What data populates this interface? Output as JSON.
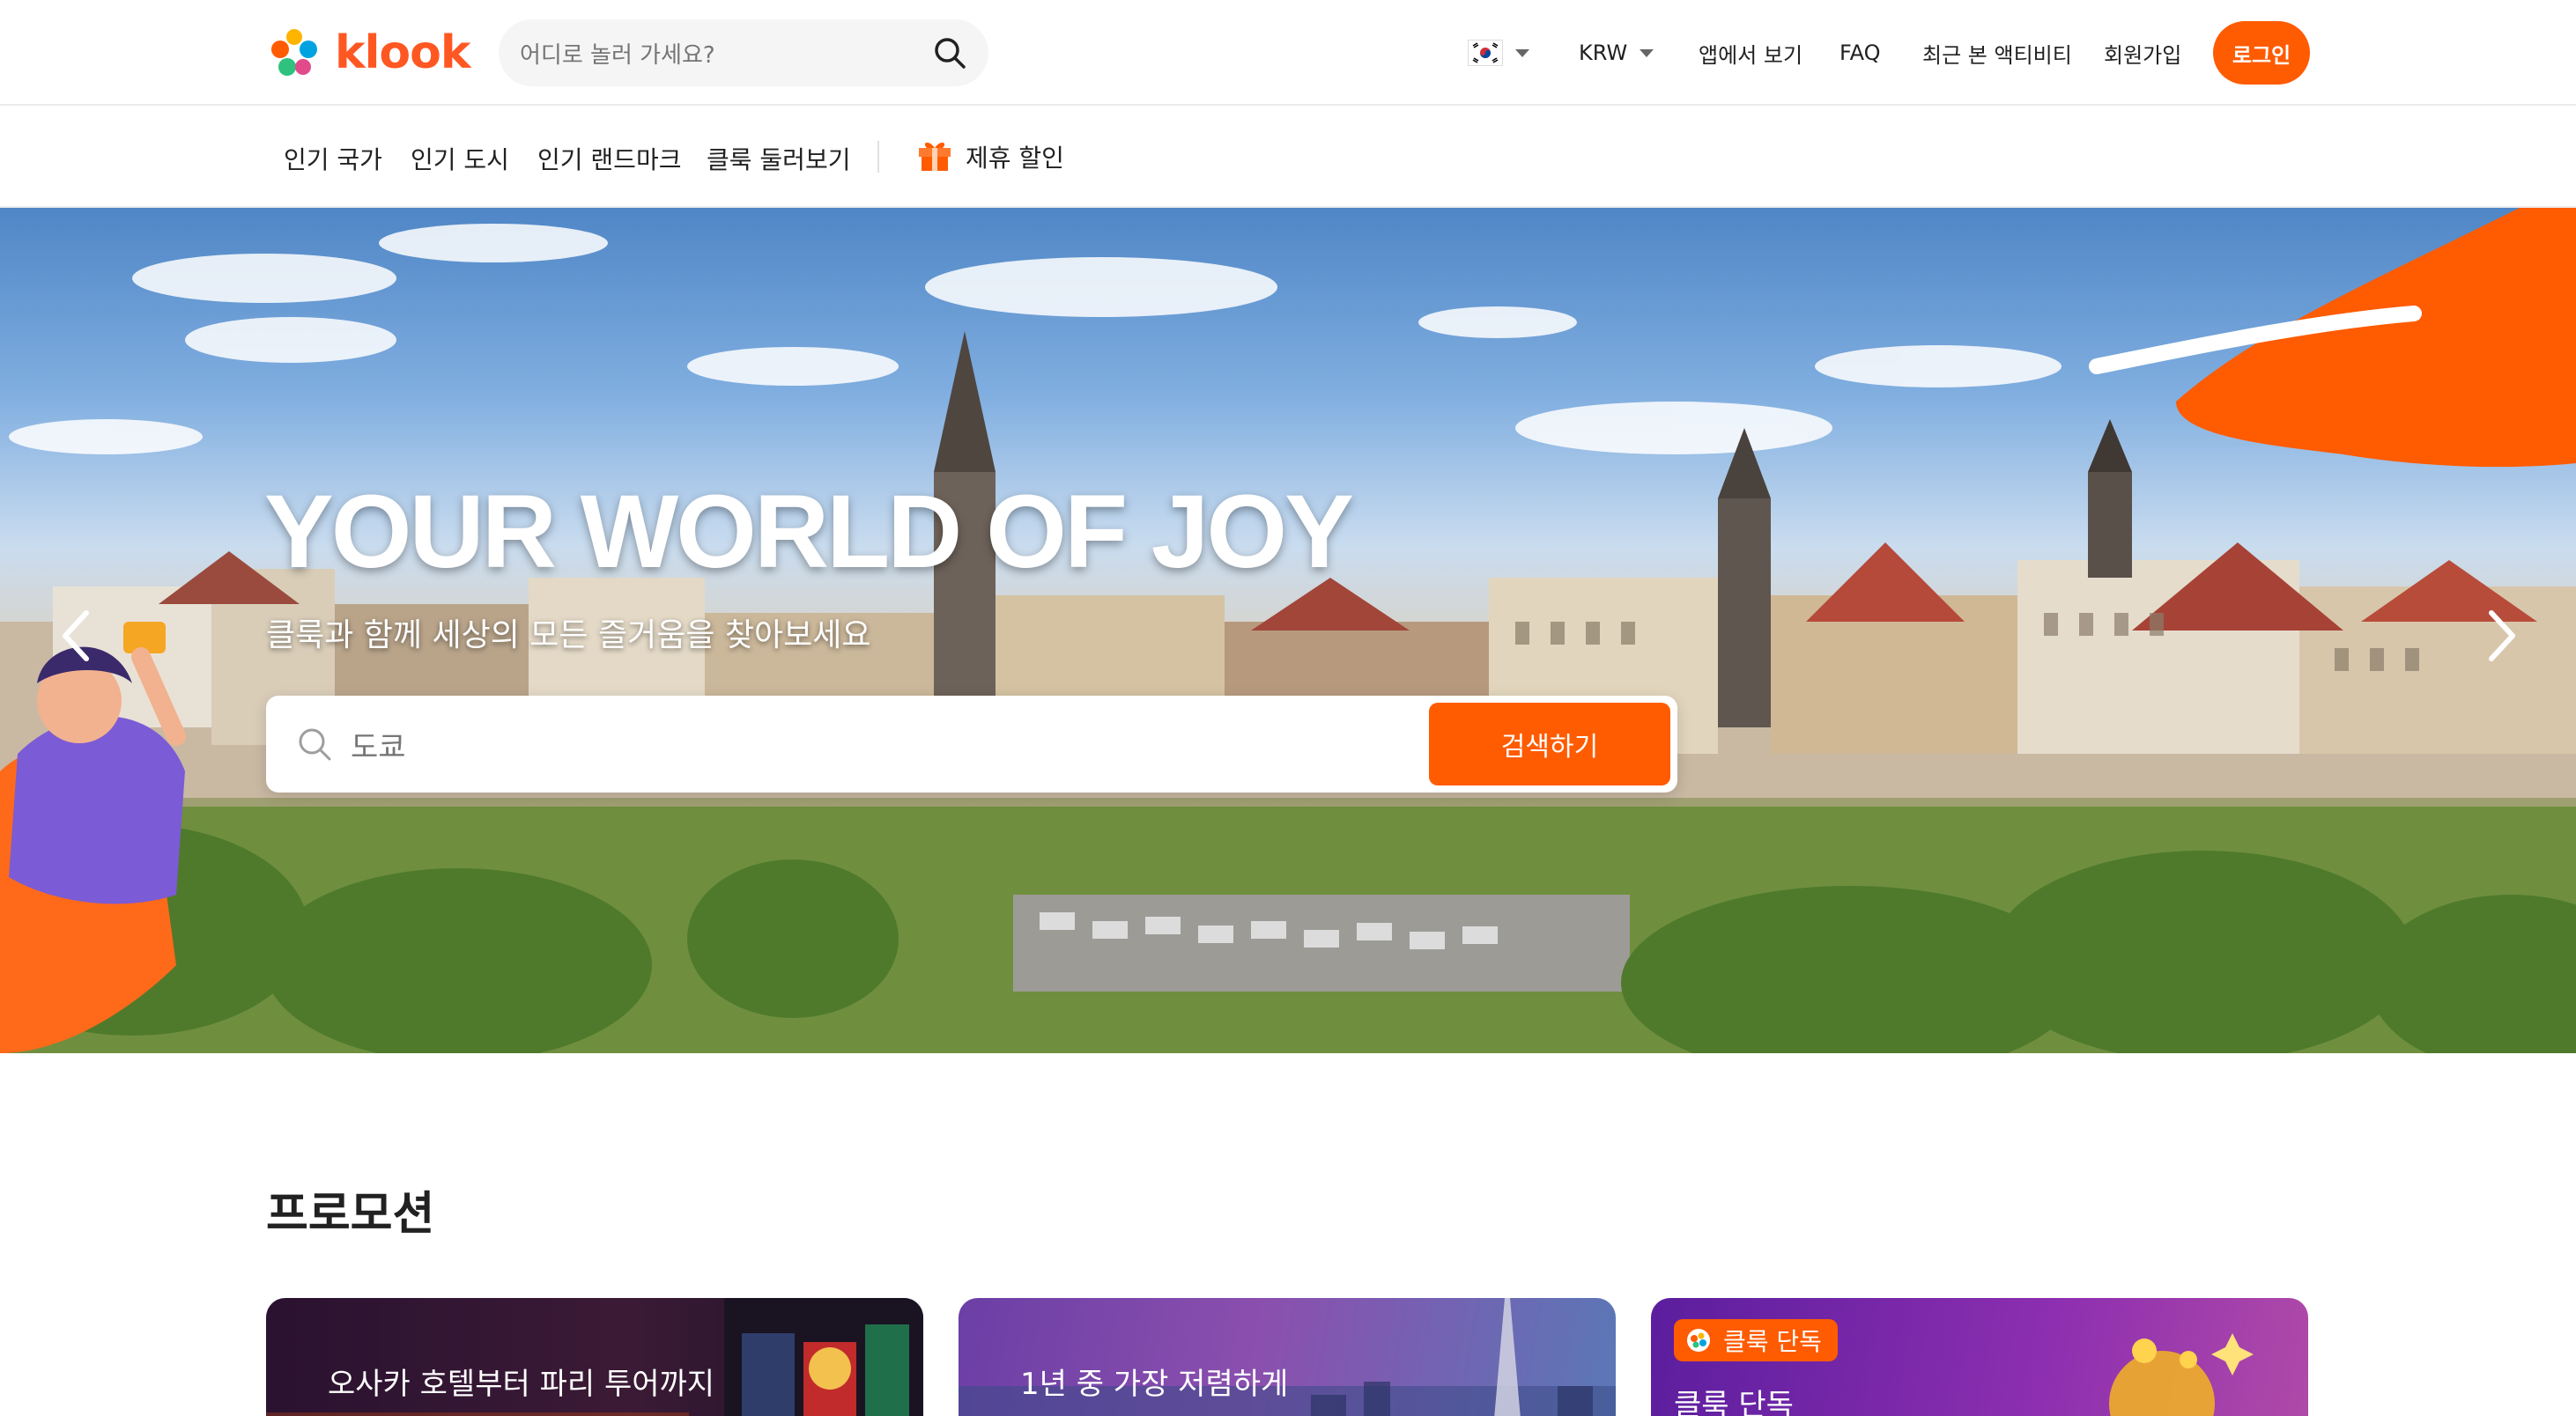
{
  "brand": {
    "name": "klook",
    "accent": "#ff5b00"
  },
  "header": {
    "search_placeholder": "어디로 놀러 가세요?",
    "locale_flag": "korea-flag-icon",
    "currency": "KRW",
    "links": {
      "app": "앱에서 보기",
      "faq": "FAQ",
      "recent": "최근 본 액티비티",
      "signup": "회원가입"
    },
    "login": "로그인"
  },
  "subnav": {
    "items": [
      "인기 국가",
      "인기 도시",
      "인기 랜드마크",
      "클룩 둘러보기"
    ],
    "promo": "제휴 할인"
  },
  "hero": {
    "title": "YOUR WORLD OF JOY",
    "subtitle": "클룩과 함께 세상의 모든 즐거움을 찾아보세요",
    "search_value": "도쿄",
    "search_button": "검색하기"
  },
  "promotions": {
    "title": "프로모션",
    "cards": [
      {
        "line1": "오사카 호텔부터 파리 투어까지"
      },
      {
        "line1": "1년 중 가장 저렴하게"
      },
      {
        "badge": "클룩 단독",
        "line1": "클룩 단독"
      }
    ]
  }
}
